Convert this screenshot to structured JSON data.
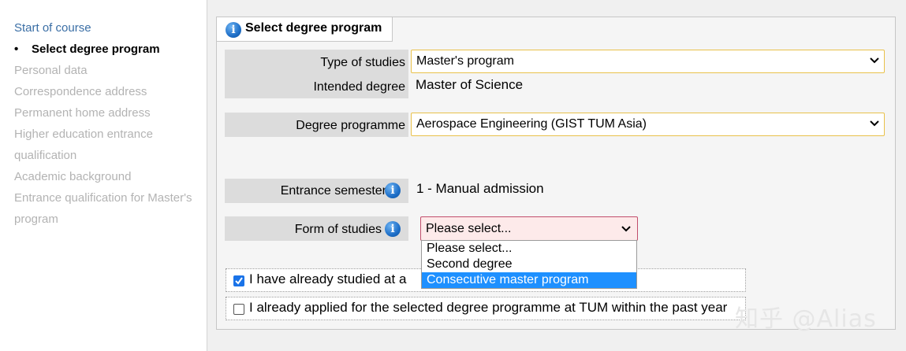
{
  "sidebar": {
    "items": [
      {
        "label": "Start of course",
        "state": "link"
      },
      {
        "label": "Select degree program",
        "state": "current"
      },
      {
        "label": "Personal data",
        "state": "disabled"
      },
      {
        "label": "Correspondence address",
        "state": "disabled"
      },
      {
        "label": "Permanent home address",
        "state": "disabled"
      },
      {
        "label": "Higher education entrance",
        "state": "disabled"
      },
      {
        "label": "qualification",
        "state": "disabled"
      },
      {
        "label": "Academic background",
        "state": "disabled"
      },
      {
        "label": "Entrance qualification for Master's",
        "state": "disabled"
      },
      {
        "label": "program",
        "state": "disabled"
      }
    ],
    "bullet": "•"
  },
  "panel": {
    "tab_title": "Select degree program",
    "info_glyph": "i"
  },
  "form": {
    "type_of_studies": {
      "label": "Type of studies",
      "value": "Master's program"
    },
    "intended_degree": {
      "label": "Intended degree",
      "value": "Master of Science"
    },
    "degree_programme": {
      "label": "Degree programme",
      "value": "Aerospace Engineering (GIST TUM Asia)"
    },
    "entrance_semester": {
      "label": "Entrance semester",
      "value": "1 - Manual admission"
    },
    "form_of_studies": {
      "label": "Form of studies",
      "value": "Please select...",
      "options": [
        "Please select...",
        "Second degree",
        "Consecutive master program"
      ],
      "highlighted_option": "Consecutive master program"
    }
  },
  "checkboxes": [
    {
      "label": "I have already studied at a",
      "checked": true
    },
    {
      "label": "I already applied for the selected degree programme at TUM within the past year",
      "checked": false
    }
  ],
  "watermark": "知乎 @Alias",
  "colors": {
    "select_border": "#e9c14a",
    "invalid_select_bg": "#fdeaea",
    "invalid_select_border": "#c14d6b",
    "highlight": "#1e90ff",
    "link": "#3a6ea5"
  }
}
